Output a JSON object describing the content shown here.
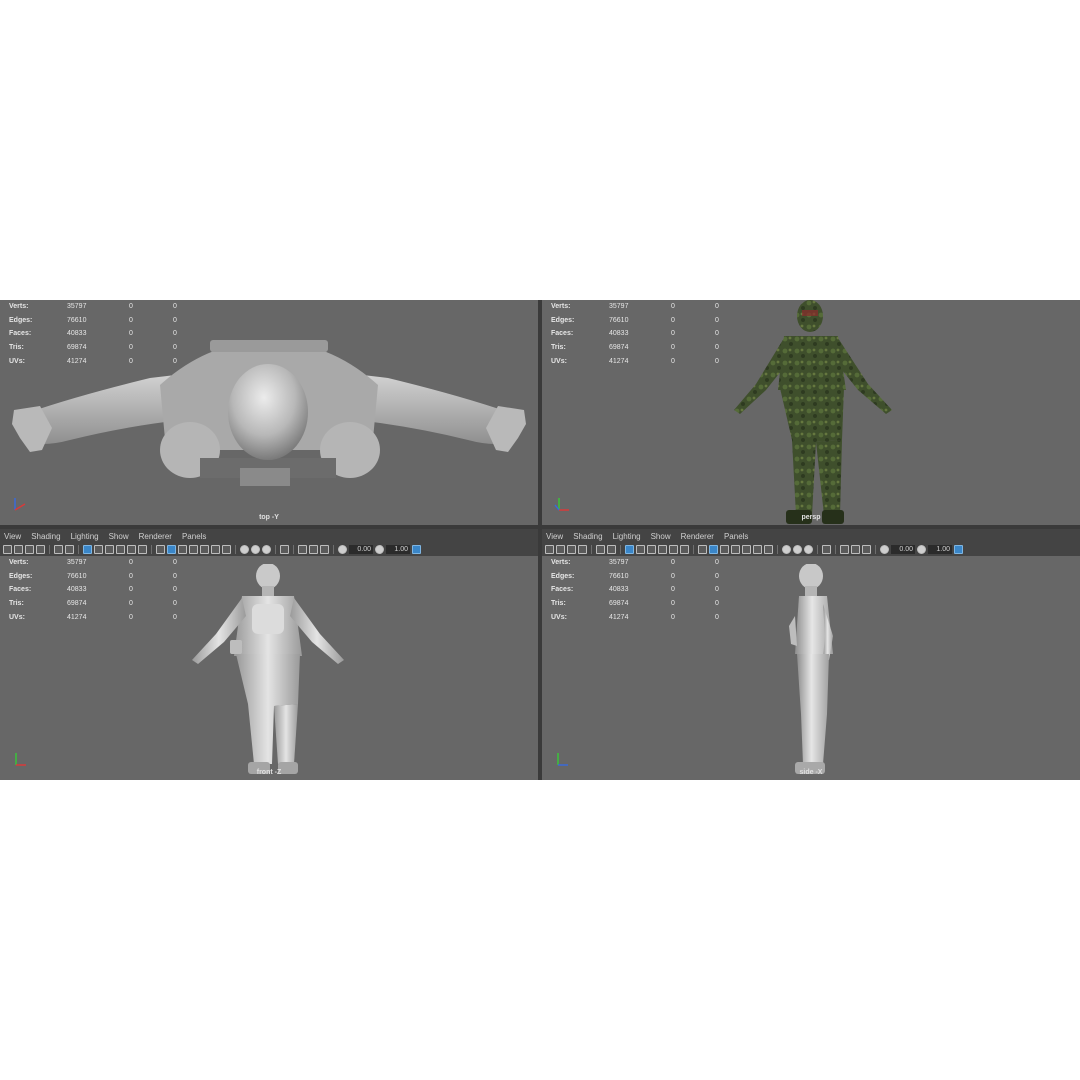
{
  "menu": [
    "View",
    "Shading",
    "Lighting",
    "Show",
    "Renderer",
    "Panels"
  ],
  "stats": {
    "rows": [
      {
        "label": "Verts:",
        "value": "35797",
        "sel": "0",
        "uv": "0"
      },
      {
        "label": "Edges:",
        "value": "76610",
        "sel": "0",
        "uv": "0"
      },
      {
        "label": "Faces:",
        "value": "40833",
        "sel": "0",
        "uv": "0"
      },
      {
        "label": "Tris:",
        "value": "69874",
        "sel": "0",
        "uv": "0"
      },
      {
        "label": "UVs:",
        "value": "41274",
        "sel": "0",
        "uv": "0"
      }
    ]
  },
  "toolbar": {
    "exposure": "0.00",
    "gamma": "1.00"
  },
  "viewports": {
    "top": {
      "camera": "top -Y"
    },
    "persp": {
      "camera": "persp"
    },
    "front": {
      "camera": "front -Z"
    },
    "side": {
      "camera": "side -X"
    }
  },
  "colors": {
    "viewport_bg": "#676767",
    "menu_bg": "#444444",
    "model_grey": "#c8c8c8",
    "camo_green": "#3f4f2c",
    "axis_x": "#d83a3a",
    "axis_y": "#3ac43a",
    "axis_z": "#3a6ad8"
  }
}
